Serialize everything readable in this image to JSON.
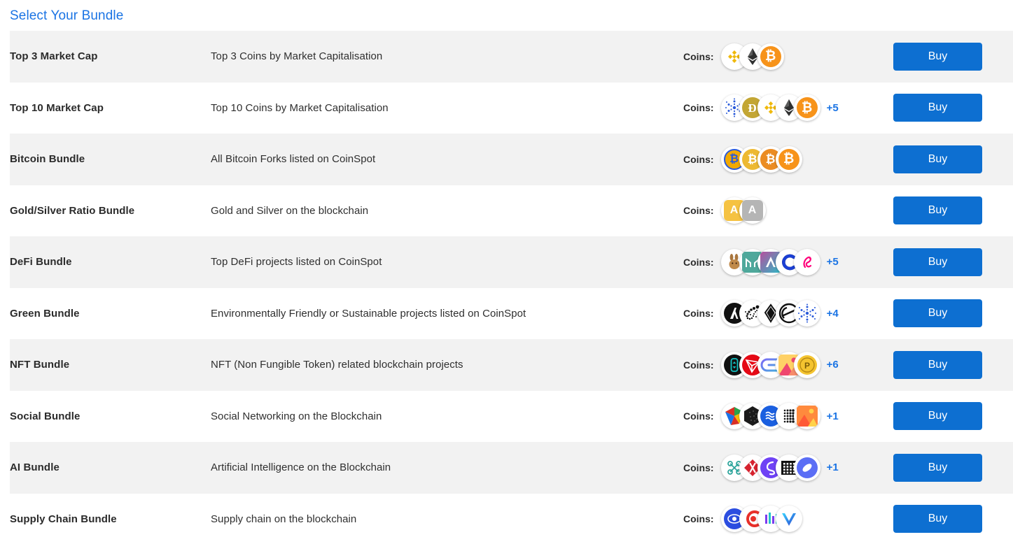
{
  "page": {
    "title": "Select Your Bundle",
    "title_color": "#1b74e4",
    "accent_color": "#0d6fd1",
    "stripe_color": "#f2f2f2",
    "coins_label": "Coins:",
    "buy_label": "Buy"
  },
  "bundles": [
    {
      "name": "Top 3 Market Cap",
      "description": "Top 3 Coins by Market Capitalisation",
      "coins_label": "Coins:",
      "more": "",
      "buy_label": "Buy",
      "icons": [
        "binance-icon",
        "ethereum-icon",
        "bitcoin-icon"
      ]
    },
    {
      "name": "Top 10 Market Cap",
      "description": "Top 10 Coins by Market Capitalisation",
      "coins_label": "Coins:",
      "more": "+5",
      "buy_label": "Buy",
      "icons": [
        "cardano-icon",
        "dogecoin-icon",
        "binance-icon",
        "ethereum-icon",
        "bitcoin-icon"
      ]
    },
    {
      "name": "Bitcoin Bundle",
      "description": "All Bitcoin Forks listed on CoinSpot",
      "coins_label": "Coins:",
      "more": "",
      "buy_label": "Buy",
      "icons": [
        "bitcoin-gold-icon",
        "bitcoin-cash-icon",
        "bitcoin-sv-icon",
        "bitcoin-icon"
      ]
    },
    {
      "name": "Gold/Silver Ratio Bundle",
      "description": "Gold and Silver on the blockchain",
      "coins_label": "Coins:",
      "more": "",
      "buy_label": "Buy",
      "icons": [
        "gold-token-icon",
        "silver-token-icon"
      ]
    },
    {
      "name": "DeFi Bundle",
      "description": "Top DeFi projects listed on CoinSpot",
      "coins_label": "Coins:",
      "more": "+5",
      "buy_label": "Buy",
      "icons": [
        "pancakeswap-icon",
        "maker-icon",
        "aave-icon",
        "compound-icon",
        "uniswap-icon"
      ]
    },
    {
      "name": "Green Bundle",
      "description": "Environmentally Friendly or Sustainable projects listed on CoinSpot",
      "coins_label": "Coins:",
      "more": "+4",
      "buy_label": "Buy",
      "icons": [
        "algorand-icon",
        "iota-icon",
        "eos-icon",
        "stellar-icon",
        "cardano-icon"
      ]
    },
    {
      "name": "NFT Bundle",
      "description": "NFT (Non Fungible Token) related blockchain projects",
      "coins_label": "Coins:",
      "more": "+6",
      "buy_label": "Buy",
      "icons": [
        "bitdao-icon",
        "tron-icon",
        "enjin-icon",
        "superrare-icon",
        "pundix-icon"
      ]
    },
    {
      "name": "Social Bundle",
      "description": "Social Networking on the Blockchain",
      "coins_label": "Coins:",
      "more": "+1",
      "buy_label": "Buy",
      "icons": [
        "status-icon",
        "hive-icon",
        "steem-icon",
        "mask-icon",
        "rally-icon"
      ]
    },
    {
      "name": "AI Bundle",
      "description": "Artificial Intelligence on the Blockchain",
      "coins_label": "Coins:",
      "more": "+1",
      "buy_label": "Buy",
      "icons": [
        "fetch-ai-icon",
        "singularitynet-icon",
        "numeraire-icon",
        "matrix-ai-icon",
        "ocean-protocol-icon"
      ]
    },
    {
      "name": "Supply Chain Bundle",
      "description": "Supply chain on the blockchain",
      "coins_label": "Coins:",
      "more": "",
      "buy_label": "Buy",
      "icons": [
        "waltonchain-icon",
        "cargox-icon",
        "morpheus-icon",
        "vechain-icon"
      ]
    }
  ]
}
